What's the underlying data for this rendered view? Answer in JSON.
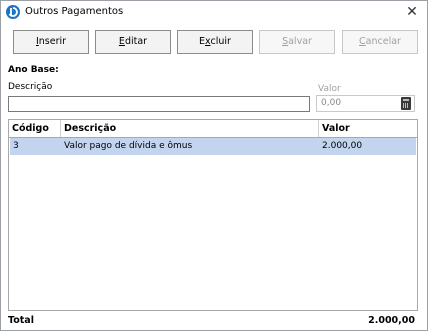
{
  "window": {
    "title": "Outros Pagamentos",
    "close_glyph": "✕"
  },
  "toolbar": {
    "buttons": [
      {
        "prefix": "",
        "accel": "I",
        "suffix": "nserir",
        "enabled": true
      },
      {
        "prefix": "",
        "accel": "E",
        "suffix": "ditar",
        "enabled": true
      },
      {
        "prefix": "E",
        "accel": "x",
        "suffix": "cluir",
        "enabled": true
      },
      {
        "prefix": "",
        "accel": "S",
        "suffix": "alvar",
        "enabled": false
      },
      {
        "prefix": "",
        "accel": "C",
        "suffix": "ancelar",
        "enabled": false
      }
    ]
  },
  "form": {
    "ano_base_label": "Ano Base:",
    "descricao_label": "Descrição",
    "descricao_value": "",
    "valor_label": "Valor",
    "valor_value": "0,00"
  },
  "grid": {
    "columns": [
      "Código",
      "Descrição",
      "Valor"
    ],
    "rows": [
      {
        "codigo": "3",
        "descricao": "Valor pago de dívida e ômus",
        "valor": "2.000,00"
      }
    ]
  },
  "footer": {
    "total_label": "Total",
    "total_value": "2.000,00"
  },
  "colors": {
    "selected_row": "#c3d4ee",
    "app_icon": "#1f73c4"
  }
}
